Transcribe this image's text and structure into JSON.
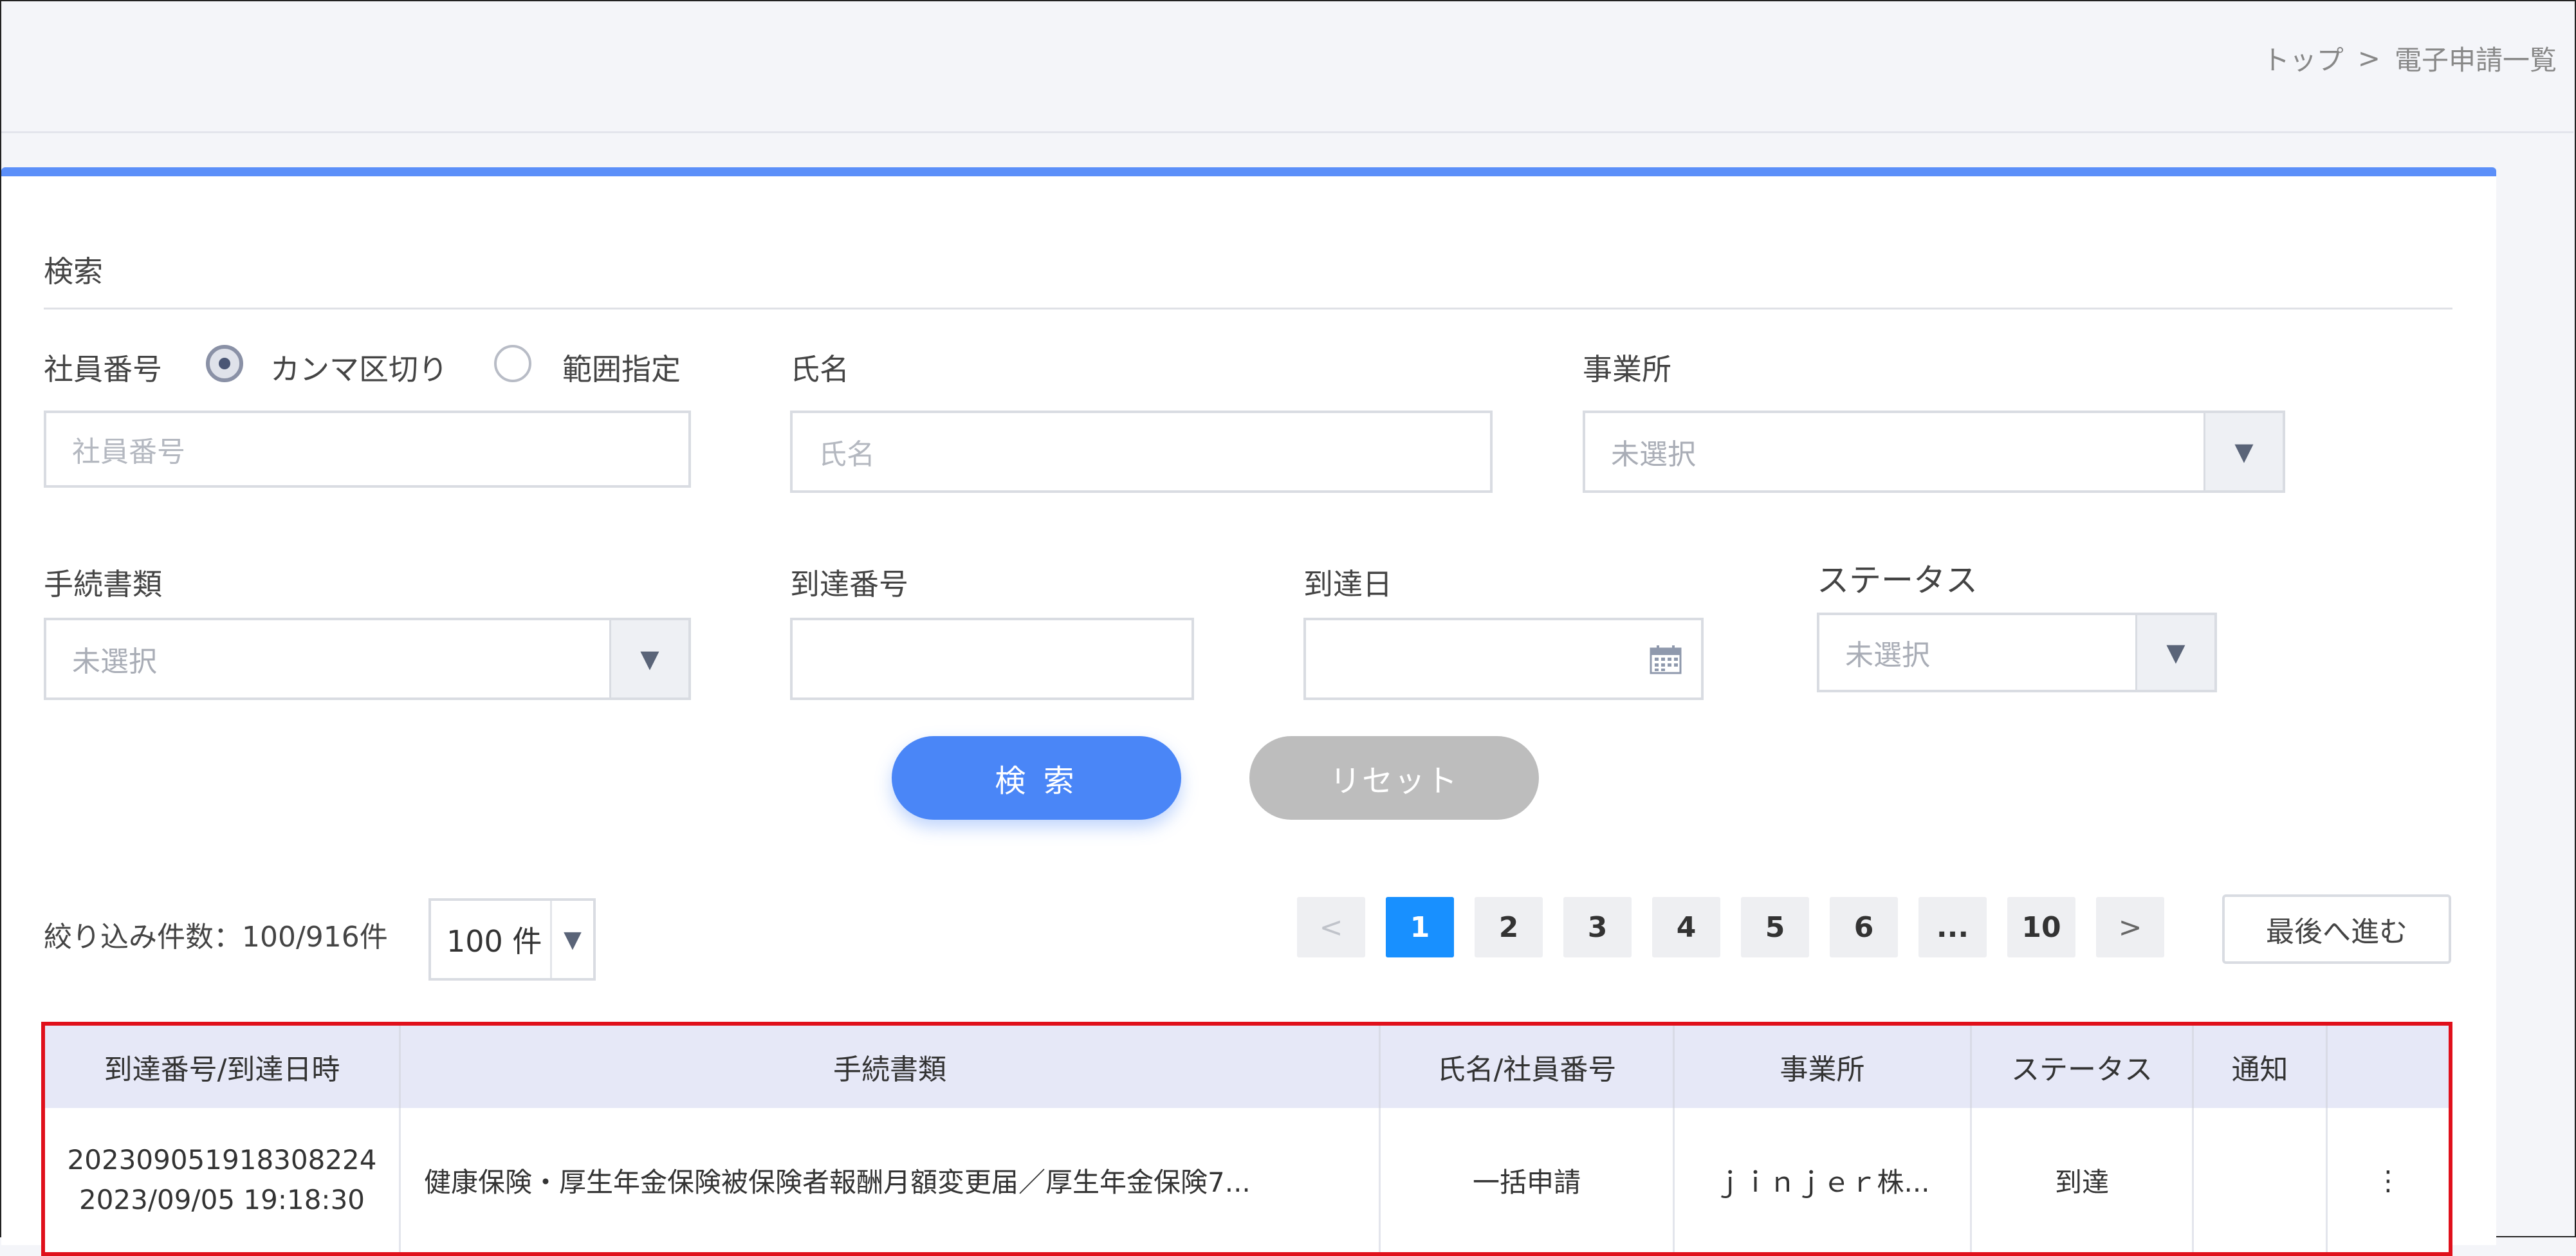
{
  "breadcrumb": {
    "home": "トップ",
    "separator": ">",
    "current": "電子申請一覧"
  },
  "search": {
    "title": "検索",
    "employee_number": {
      "label": "社員番号",
      "options": [
        "カンマ区切り",
        "範囲指定"
      ],
      "selected": "カンマ区切り",
      "placeholder": "社員番号"
    },
    "name": {
      "label": "氏名",
      "placeholder": "氏名"
    },
    "office": {
      "label": "事業所",
      "placeholder": "未選択"
    },
    "procedure": {
      "label": "手続書類",
      "placeholder": "未選択"
    },
    "arrival_number": {
      "label": "到達番号",
      "placeholder": ""
    },
    "arrival_date": {
      "label": "到達日",
      "placeholder": ""
    },
    "status": {
      "label": "ステータス",
      "placeholder": "未選択"
    },
    "search_button": "検 索",
    "reset_button": "リセット"
  },
  "results": {
    "count_text": "絞り込み件数：100/916件",
    "per_page": "100 件",
    "pagination": {
      "prev": "<",
      "pages": [
        "1",
        "2",
        "3",
        "4",
        "5",
        "6",
        "...",
        "10"
      ],
      "current": "1",
      "next": ">",
      "last_button": "最後へ進む"
    }
  },
  "table": {
    "columns": [
      "到達番号/到達日時",
      "手続書類",
      "氏名/社員番号",
      "事業所",
      "ステータス",
      "通知",
      ""
    ],
    "rows": [
      {
        "arrival_number": "20230905191830822​4",
        "arrival_datetime": "2023/09/05 19:18:30",
        "procedure": "健康保険・厚生年金保険被保険者報酬月額変更届／厚生年金保険7...",
        "name": "一括申請",
        "office": "ｊｉｎｊｅｒ株...",
        "status": "到達",
        "notice": "",
        "menu": "⋮"
      }
    ]
  },
  "colors": {
    "accent": "#4a86f7",
    "active_page": "#1890ff",
    "highlight_border": "#e0101b",
    "header_bg": "#e6e8f7"
  }
}
